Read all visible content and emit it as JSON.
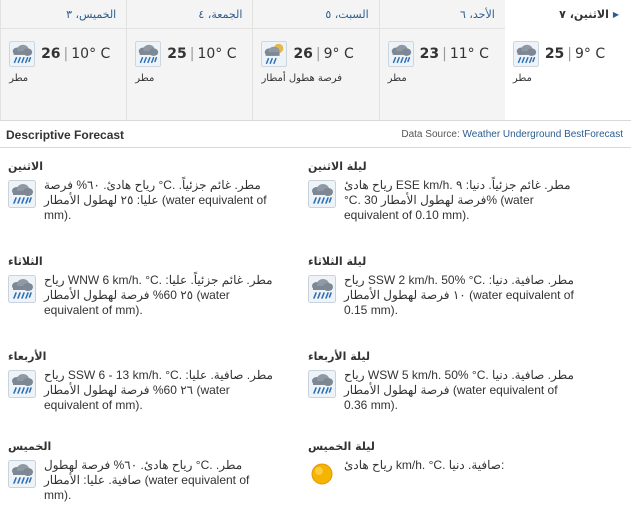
{
  "tabs": [
    {
      "day": "الاثنين، ٧",
      "active": true,
      "high": "25",
      "low": "9° C",
      "cond": "مطر",
      "icon": "rain-icon"
    },
    {
      "day": "الأحد، ٦",
      "active": false,
      "high": "23",
      "low": "11° C",
      "cond": "مطر",
      "icon": "rain-icon"
    },
    {
      "day": "السبت، ٥",
      "active": false,
      "high": "26",
      "low": "9° C",
      "cond": "فرصة هطول أمطار",
      "icon": "chance-rain-icon"
    },
    {
      "day": "الجمعة، ٤",
      "active": false,
      "high": "25",
      "low": "10° C",
      "cond": "مطر",
      "icon": "rain-icon"
    },
    {
      "day": "الخميس، ٣",
      "active": false,
      "high": "26",
      "low": "10° C",
      "cond": "مطر",
      "icon": "rain-icon"
    }
  ],
  "section": {
    "title": "Descriptive Forecast",
    "source_prefix": "Data Source: ",
    "source_link": "Weather Underground BestForecast"
  },
  "forecasts": {
    "mon_night": {
      "title": "ليلة الاثنين",
      "icon": "rain-icon",
      "text": "رياح هادئ ESE km/h. مطر. غائم جزئياً. دنيا: ٩ °C. فرصة لهطول الأمطار 30% (water equivalent of 0.10 mm)."
    },
    "mon": {
      "title": "الاثنين",
      "icon": "rain-icon",
      "text": "رياح هادئ. ٦٠% فرصة °C. مطر. غائم جزئياً. عليا: ٢٥ لهطول الأمطار (water equivalent of mm)."
    },
    "tue_night": {
      "title": "ليلة الثلاثاء",
      "icon": "rain-icon",
      "text": "رياح SSW 2 km/h. 50% °C. مطر. صافية. دنيا: ١٠ فرصة لهطول الأمطار (water equivalent of 0.15 mm)."
    },
    "tue": {
      "title": "الثلاثاء",
      "icon": "rain-icon",
      "text": "رياح WNW 6 km/h. °C. مطر. غائم جزئياً. عليا: ٢٥ 60% فرصة لهطول الأمطار (water equivalent of mm)."
    },
    "wed_night": {
      "title": "ليلة الأربعاء",
      "icon": "rain-icon",
      "text": "رياح WSW 5 km/h. 50% °C. مطر. صافية. دنيا فرصة لهطول الأمطار (water equivalent of 0.36 mm)."
    },
    "wed": {
      "title": "الأربعاء",
      "icon": "rain-icon",
      "text": "رياح SSW 6 - 13 km/h. °C. مطر. صافية. عليا: ٢٦ 60% فرصة لهطول الأمطار (water equivalent of mm)."
    },
    "thu_night": {
      "title": "ليلة الخميس",
      "icon": "sun-icon",
      "text": "رياح هادئ km/h. °C. صافية. دنيا:"
    },
    "thu": {
      "title": "الخميس",
      "icon": "rain-icon",
      "text": "رياح هادئ. ٦٠% فرصة لهطول °C. مطر. صافية. عليا: الأمطار (water equivalent of mm)."
    }
  },
  "colors": {
    "link": "#2c5d8f",
    "tab_bg": "#f4f4f4",
    "border": "#d9d9d9",
    "sun": "#f5b400"
  }
}
